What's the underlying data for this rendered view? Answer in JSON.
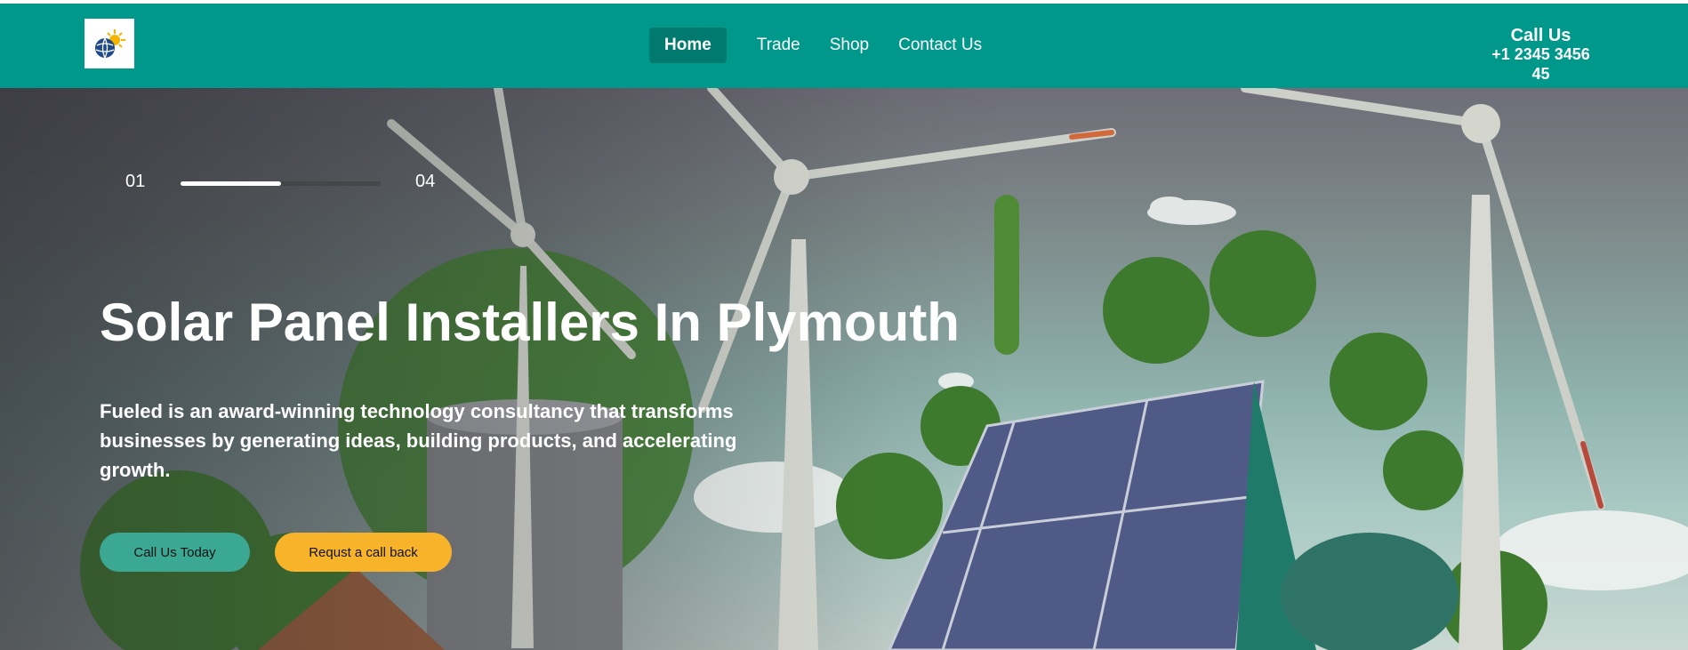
{
  "header": {
    "nav": [
      {
        "label": "Home",
        "active": true
      },
      {
        "label": "Trade",
        "active": false
      },
      {
        "label": "Shop",
        "active": false
      },
      {
        "label": "Contact Us",
        "active": false
      }
    ],
    "call": {
      "label": "Call Us",
      "phone": "+1 2345 3456 45"
    },
    "logo_icon": "sun-globe-icon"
  },
  "hero": {
    "slider": {
      "current": "01",
      "total": "04",
      "progress": 0.5
    },
    "title": "Solar Panel Installers In Plymouth",
    "description": "Fueled is an award-winning technology consultancy that transforms businesses by generating ideas, building products, and accelerating growth.",
    "buttons": {
      "primary": "Call Us Today",
      "secondary": "Requst a call back"
    }
  },
  "colors": {
    "navbar": "#00988a",
    "nav_active": "#007a6f",
    "primary_button": "#3aa892",
    "secondary_button": "#f7b42a"
  }
}
